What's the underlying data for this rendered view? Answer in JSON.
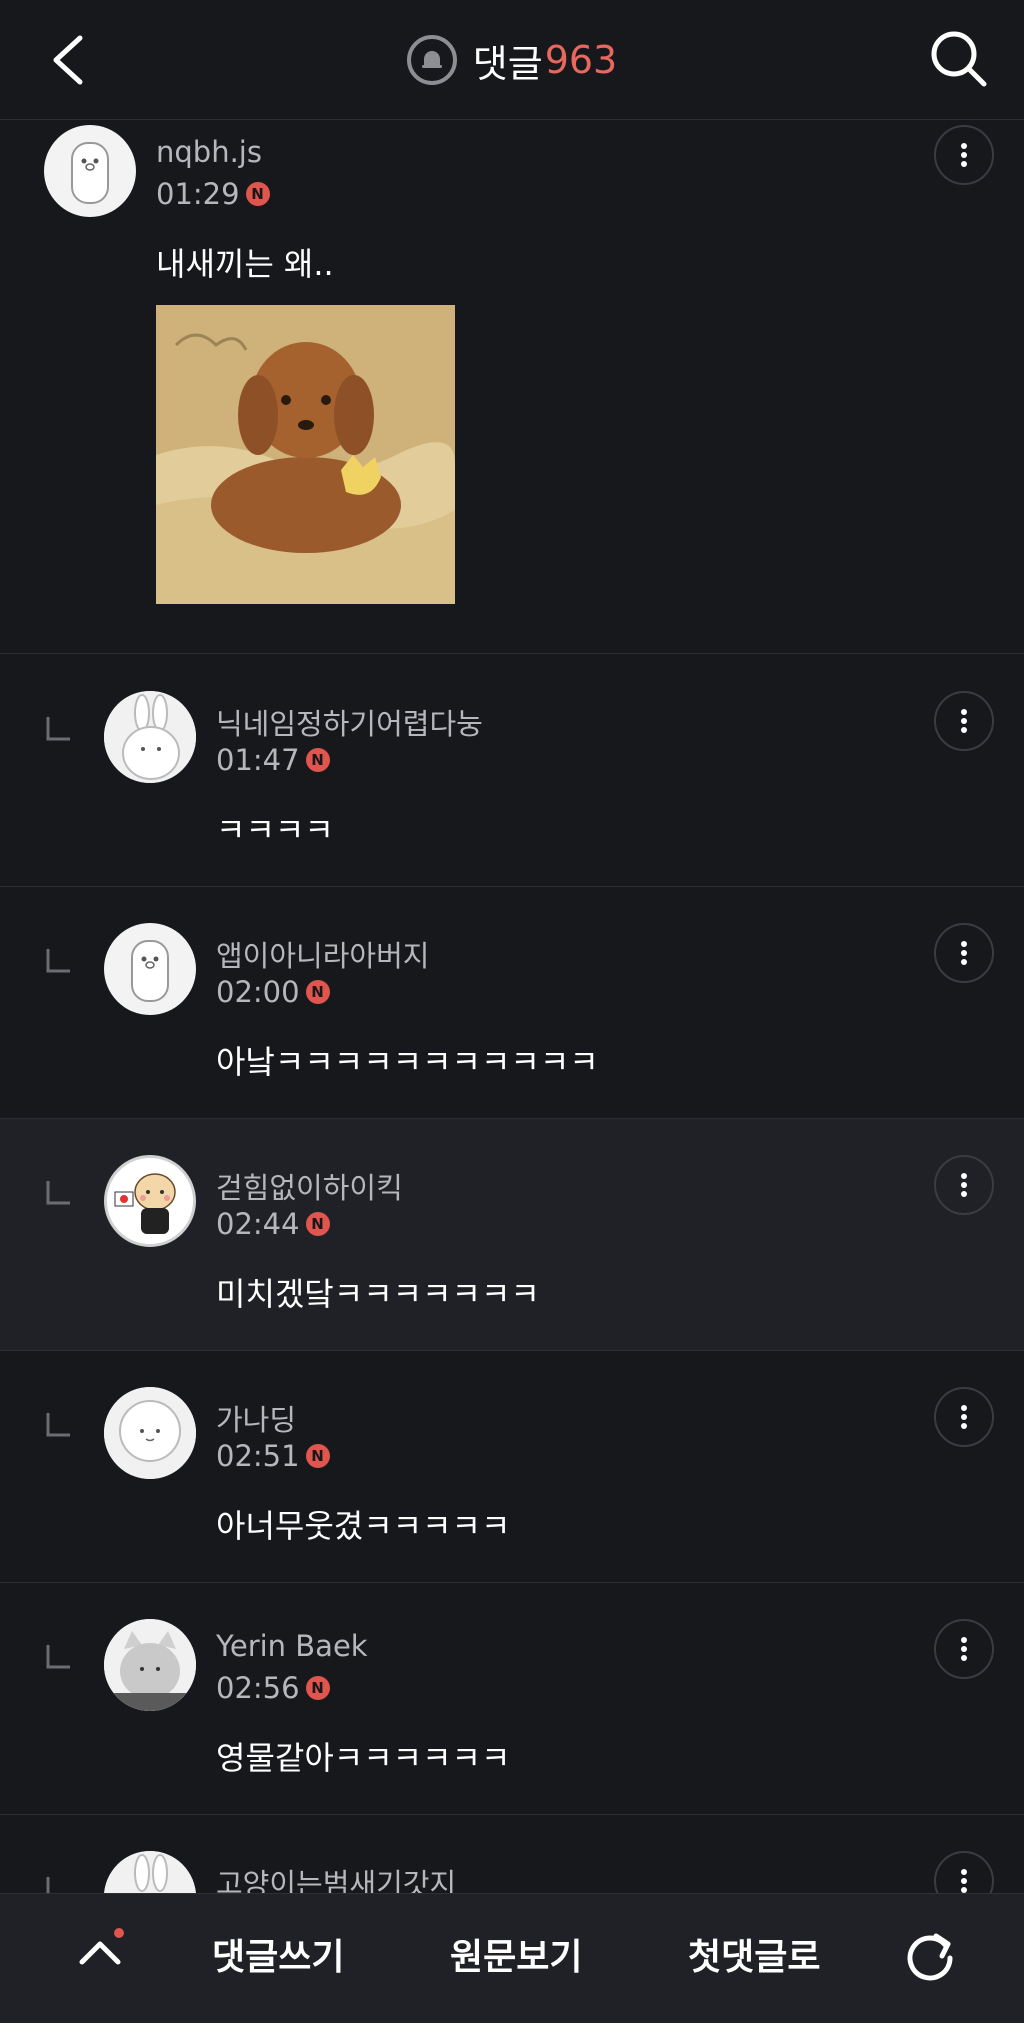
{
  "header": {
    "title": "댓글",
    "count": "963",
    "icons": {
      "back": "chevron-left-icon",
      "bell": "bell-icon",
      "search": "search-icon"
    }
  },
  "main_post": {
    "username": "nqbh.js",
    "time": "01:29",
    "badge": "N",
    "text": "내새끼는 왜..",
    "image_alt": "brown-poodle-puppy-illustration"
  },
  "replies": [
    {
      "username": "닉네임정하기어렵다눙",
      "time": "01:47",
      "badge": "N",
      "text": "ㅋㅋㅋㅋ"
    },
    {
      "username": "앱이아니라아버지",
      "time": "02:00",
      "badge": "N",
      "text": "아낰ㅋㅋㅋㅋㅋㅋㅋㅋㅋㅋㅋ"
    },
    {
      "username": "걷힘없이하이킥",
      "time": "02:44",
      "badge": "N",
      "text": "미치겠닼ㅋㅋㅋㅋㅋㅋㅋ"
    },
    {
      "username": "가나딩",
      "time": "02:51",
      "badge": "N",
      "text": "아너무웃겼ㅋㅋㅋㅋㅋ"
    },
    {
      "username": "Yerin Baek",
      "time": "02:56",
      "badge": "N",
      "text": "영물같아ㅋㅋㅋㅋㅋㅋ"
    },
    {
      "username": "고양이는범새기갓지",
      "time": "",
      "badge": "",
      "text": ""
    }
  ],
  "bottom_bar": {
    "write_label": "댓글쓰기",
    "original_label": "원문보기",
    "first_label": "첫댓글로",
    "icons": {
      "up": "chevron-up-icon",
      "refresh": "refresh-icon"
    }
  },
  "colors": {
    "background": "#17181c",
    "accent": "#e8685e",
    "badge": "#e0554d",
    "muted_text": "#b5b7bc"
  }
}
